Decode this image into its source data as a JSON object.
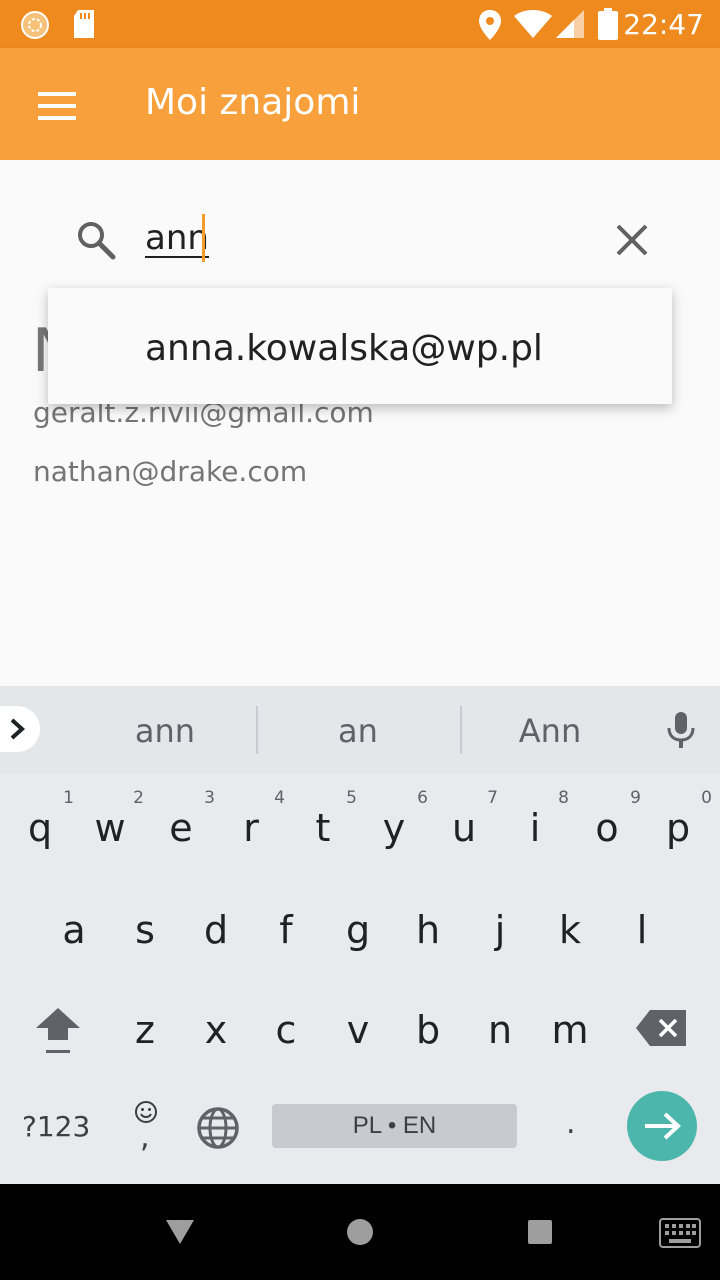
{
  "status_bar": {
    "time": "22:47"
  },
  "app_bar": {
    "title": "Moi znajomi"
  },
  "search": {
    "value": "ann"
  },
  "list": {
    "heading_partial": "N",
    "emails": [
      "geralt.z.rivii@gmail.com",
      "nathan@drake.com"
    ]
  },
  "dropdown": {
    "suggestion": "anna.kowalska@wp.pl"
  },
  "keyboard": {
    "suggestions": [
      "ann",
      "an",
      "Ann"
    ],
    "row1": [
      {
        "ch": "q",
        "d": "1"
      },
      {
        "ch": "w",
        "d": "2"
      },
      {
        "ch": "e",
        "d": "3"
      },
      {
        "ch": "r",
        "d": "4"
      },
      {
        "ch": "t",
        "d": "5"
      },
      {
        "ch": "y",
        "d": "6"
      },
      {
        "ch": "u",
        "d": "7"
      },
      {
        "ch": "i",
        "d": "8"
      },
      {
        "ch": "o",
        "d": "9"
      },
      {
        "ch": "p",
        "d": "0"
      }
    ],
    "row2": [
      "a",
      "s",
      "d",
      "f",
      "g",
      "h",
      "j",
      "k",
      "l"
    ],
    "row3": [
      "z",
      "x",
      "c",
      "v",
      "b",
      "n",
      "m"
    ],
    "symbols_label": "?123",
    "comma_label": ",",
    "space_label": "PL • EN",
    "period_label": "."
  }
}
